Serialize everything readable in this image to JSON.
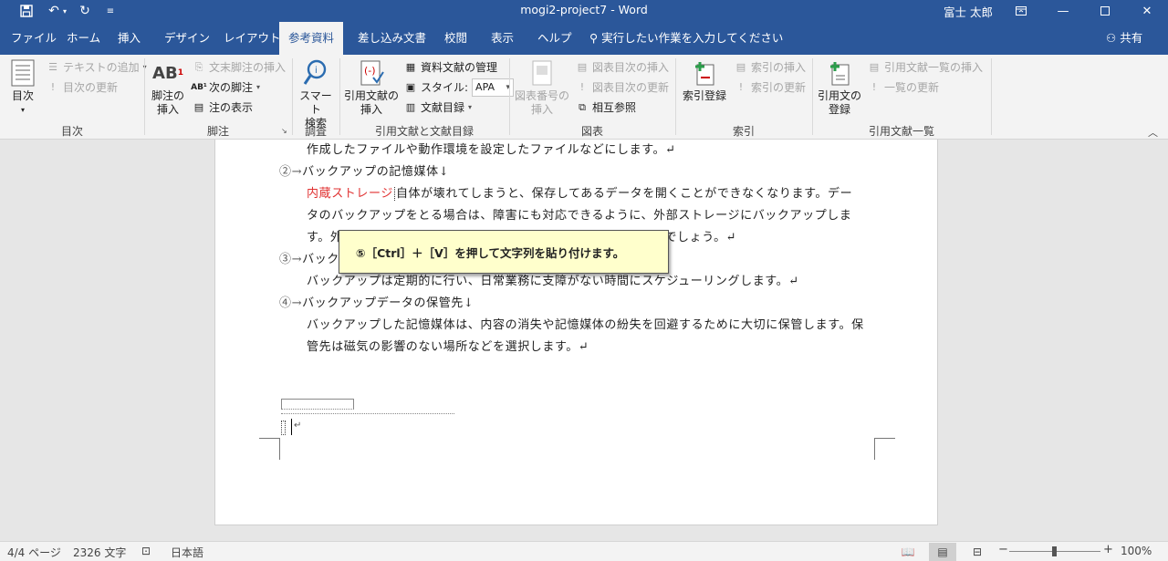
{
  "titlebar": {
    "title": "mogi2-project7  -  Word",
    "user": "富士 太郎",
    "save_icon": "save-icon",
    "undo_icon": "undo-icon",
    "redo_icon": "redo-icon"
  },
  "tabs": [
    {
      "label": "ファイル"
    },
    {
      "label": "ホーム"
    },
    {
      "label": "挿入"
    },
    {
      "label": "デザイン"
    },
    {
      "label": "レイアウト"
    },
    {
      "label": "参考資料",
      "active": true
    },
    {
      "label": "差し込み文書"
    },
    {
      "label": "校閲"
    },
    {
      "label": "表示"
    },
    {
      "label": "ヘルプ"
    }
  ],
  "tellme": "実行したい作業を入力してください",
  "share": "共有",
  "ribbon": {
    "toc": {
      "group": "目次",
      "big": "目次",
      "add_text": "テキストの追加",
      "update_toc": "目次の更新"
    },
    "footnotes": {
      "group": "脚注",
      "insert_footnote": "脚注の\n挿入",
      "insert_endnote": "文末脚注の挿入",
      "next_footnote": "次の脚注",
      "show_notes": "注の表示"
    },
    "research": {
      "group": "調査",
      "smart_lookup": "スマート\n検索"
    },
    "citations": {
      "group": "引用文献と文献目録",
      "insert_citation": "引用文献の\n挿入",
      "manage_sources": "資料文献の管理",
      "style_label": "スタイル:",
      "style_value": "APA",
      "bibliography": "文献目録"
    },
    "captions": {
      "group": "図表",
      "insert_caption": "図表番号の\n挿入",
      "insert_tof": "図表目次の挿入",
      "update_tof": "図表目次の更新",
      "cross_ref": "相互参照"
    },
    "index": {
      "group": "索引",
      "mark_entry": "索引登録",
      "insert_index": "索引の挿入",
      "update_index": "索引の更新"
    },
    "toa": {
      "group": "引用文献一覧",
      "mark_citation": "引用文の\n登録",
      "insert_toa": "引用文献一覧の挿入",
      "update_toa": "一覧の更新"
    }
  },
  "document": {
    "lines": [
      {
        "text": "作成したファイルや動作環境を設定したファイルなどにします。↵"
      },
      {
        "num": "②→",
        "text": "バックアップの記憶媒体↓"
      },
      {
        "red": "内蔵ストレージ",
        "text": "自体が壊れてしまうと、保存してあるデータを開くことができなくなります。デー"
      },
      {
        "text": "タのバックアップをとる場合は、障害にも対応できるように、外部ストレージにバックアップしま"
      },
      {
        "text": "す。外部ストレージは、データの容量にあわせて選択するとよいでしょう。↵"
      },
      {
        "num": "③→",
        "text": "バックアップの注意点↓"
      },
      {
        "text": "バックアップは定期的に行い、日常業務に支障がない時間にスケジューリングします。↵"
      },
      {
        "num": "④→",
        "text": "バックアップデータの保管先↓"
      },
      {
        "text": "バックアップした記憶媒体は、内容の消失や記憶媒体の紛失を回避するために大切に保管します。保"
      },
      {
        "text": "管先は磁気の影響のない場所などを選択します。↵"
      }
    ],
    "callout": "⑤［Ctrl］＋［V］を押して文字列を貼り付けます。"
  },
  "statusbar": {
    "page": "4/4 ページ",
    "words": "2326 文字",
    "language": "日本語",
    "zoom": "100%"
  }
}
